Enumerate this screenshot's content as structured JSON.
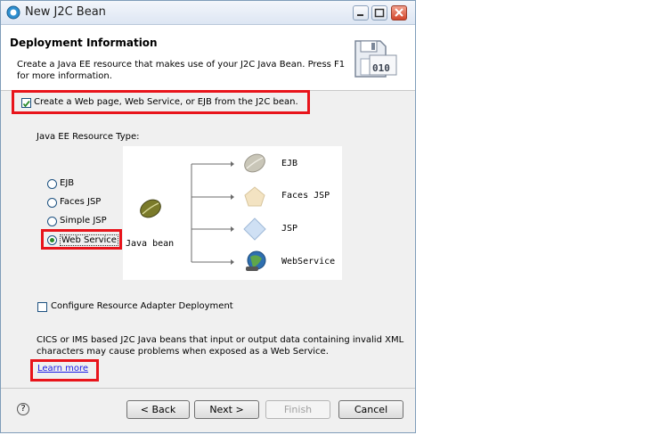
{
  "window": {
    "title": "New J2C Bean"
  },
  "header": {
    "title": "Deployment Information",
    "description": "Create a Java EE resource that makes use of your J2C Java Bean. Press F1 for more information."
  },
  "create_option": {
    "label": "Create a Web page, Web Service, or EJB from the J2C bean.",
    "checked": true
  },
  "resource_type": {
    "label": "Java EE Resource Type:",
    "options": [
      "EJB",
      "Faces JSP",
      "Simple JSP",
      "Web Service"
    ],
    "selected": "Web Service"
  },
  "diagram": {
    "source": "Java bean",
    "targets": [
      "EJB",
      "Faces JSP",
      "JSP",
      "WebService"
    ]
  },
  "configure_adapter": {
    "label": "Configure Resource Adapter Deployment",
    "checked": false
  },
  "note": {
    "line1": "CICS or IMS based J2C Java beans that input or output data containing invalid XML",
    "line2": "characters may cause problems when exposed as a Web Service.",
    "link": "Learn more"
  },
  "buttons": {
    "help": "?",
    "back": "< Back",
    "next": "Next >",
    "finish": "Finish",
    "cancel": "Cancel"
  },
  "colors": {
    "highlight": "#e8141b",
    "link": "#1a1ae6"
  }
}
